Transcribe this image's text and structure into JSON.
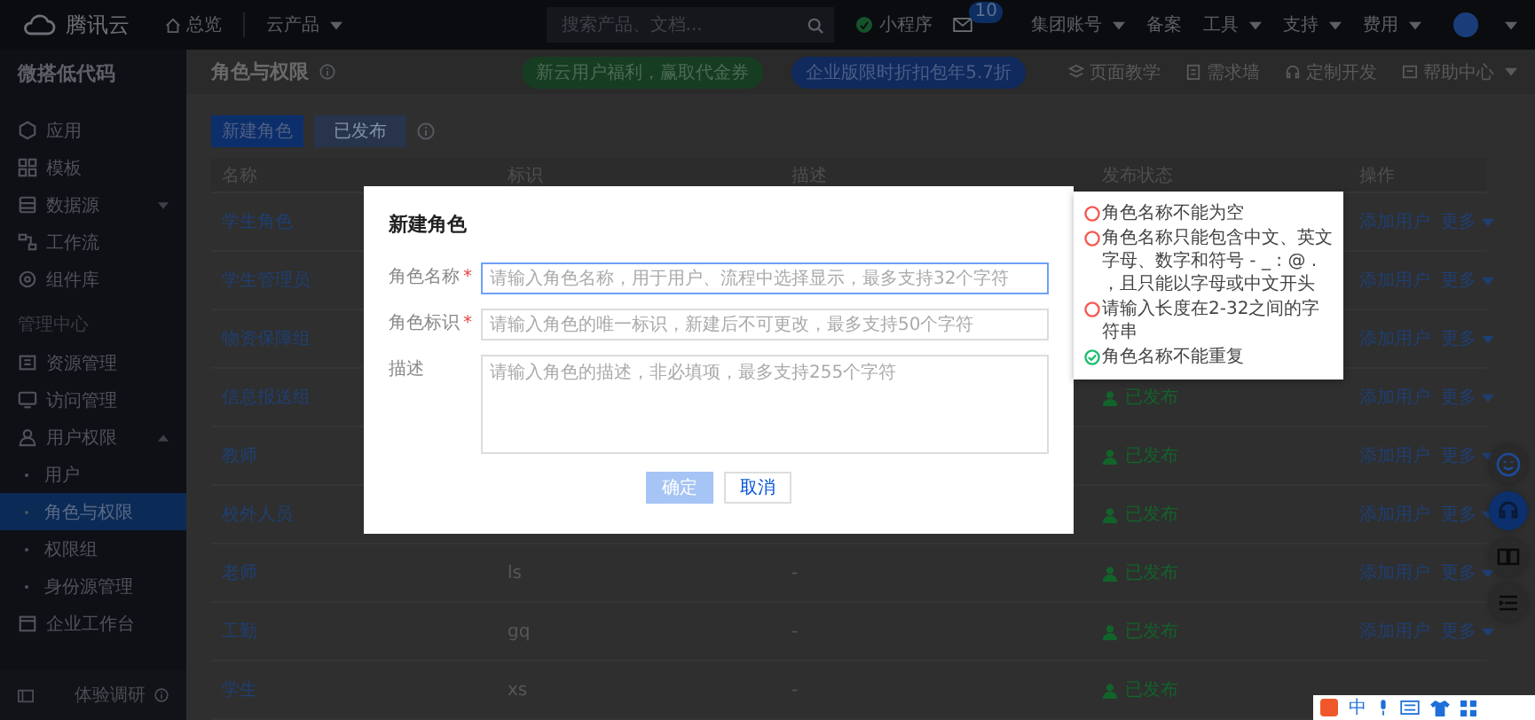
{
  "top_bar": {
    "brand": "腾讯云",
    "home": "总览",
    "products": {
      "label": "云产品",
      "dropdown": true
    },
    "search": {
      "placeholder": "搜索产品、文档..."
    },
    "mini_program": "小程序",
    "mail_badge": "10",
    "menus": [
      {
        "label": "集团账号",
        "dropdown": true
      },
      {
        "label": "备案",
        "dropdown": false
      },
      {
        "label": "工具",
        "dropdown": true
      },
      {
        "label": "支持",
        "dropdown": true
      },
      {
        "label": "费用",
        "dropdown": true
      }
    ]
  },
  "sidebar": {
    "title": "微搭低代码",
    "groups": [
      {
        "items": [
          {
            "label": "应用",
            "selected": false
          },
          {
            "label": "模板",
            "selected": false
          },
          {
            "label": "数据源",
            "selected": false,
            "expanded": false
          },
          {
            "label": "工作流",
            "selected": false
          },
          {
            "label": "组件库",
            "selected": false
          }
        ]
      },
      {
        "heading": "管理中心",
        "items": [
          {
            "label": "资源管理",
            "selected": false
          },
          {
            "label": "访问管理",
            "selected": false
          },
          {
            "label": "用户权限",
            "selected": false,
            "expanded": true,
            "children": [
              {
                "label": "用户",
                "selected": false
              },
              {
                "label": "角色与权限",
                "selected": true
              },
              {
                "label": "权限组",
                "selected": false
              },
              {
                "label": "身份源管理",
                "selected": false
              }
            ]
          },
          {
            "label": "企业工作台",
            "selected": false
          }
        ]
      }
    ],
    "footer": "体验调研"
  },
  "page_header": {
    "title": "角色与权限",
    "promos": [
      {
        "kind": "green",
        "text": "新云用户福利，赢取代金券"
      },
      {
        "kind": "blue",
        "text": "企业版限时折扣包年5.7折"
      }
    ],
    "links": [
      {
        "label": "页面教学",
        "dropdown": false
      },
      {
        "label": "需求墙",
        "dropdown": false
      },
      {
        "label": "定制开发",
        "dropdown": false
      },
      {
        "label": "帮助中心",
        "dropdown": true
      }
    ]
  },
  "toolbar": {
    "buttons": [
      {
        "label": "新建角色",
        "disabled": false
      },
      {
        "label": "已发布",
        "disabled": true
      }
    ]
  },
  "table": {
    "columns": [
      "名称",
      "标识",
      "描述",
      "发布状态",
      "操作"
    ],
    "rows": [
      {
        "name": "学生角色",
        "actions": [
          "添加用户",
          "更多"
        ]
      },
      {
        "name": "学生管理员",
        "actions": [
          "添加用户",
          "更多"
        ]
      },
      {
        "name": "物资保障组",
        "actions": [
          "添加用户",
          "更多"
        ]
      },
      {
        "name": "信息报送组",
        "status": "已发布",
        "actions": [
          "添加用户",
          "更多"
        ]
      },
      {
        "name": "教师",
        "status": "已发布",
        "actions": [
          "添加用户",
          "更多"
        ]
      },
      {
        "name": "校外人员",
        "status": "已发布",
        "actions": [
          "添加用户",
          "更多"
        ]
      },
      {
        "name": "老师",
        "identifier": "ls",
        "description": "-",
        "status": "已发布",
        "actions": [
          "添加用户",
          "更多"
        ]
      },
      {
        "name": "工勤",
        "identifier": "gq",
        "description": "-",
        "status": "已发布",
        "actions": [
          "添加用户",
          "更多"
        ]
      },
      {
        "name": "学生",
        "identifier": "xs",
        "description": "-",
        "status": "已发布"
      }
    ]
  },
  "modal": {
    "title": "新建角色",
    "fields": [
      {
        "kind": "input",
        "label": "角色名称",
        "required_mark": "*",
        "focused": true,
        "placeholder": "请输入角色名称，用于用户、流程中选择显示，最多支持32个字符"
      },
      {
        "kind": "input",
        "label": "角色标识",
        "required_mark": "*",
        "focused": false,
        "placeholder": "请输入角色的唯一标识，新建后不可更改，最多支持50个字符"
      },
      {
        "kind": "textarea",
        "label": "描述",
        "focused": false,
        "placeholder": "请输入角色的描述，非必填项，最多支持255个字符"
      }
    ],
    "buttons": [
      {
        "kind": "primary",
        "label": "确定",
        "disabled": true
      },
      {
        "kind": "default",
        "label": "取消",
        "disabled": false
      }
    ]
  },
  "validation": [
    {
      "text": "角色名称不能为空",
      "passed": false
    },
    {
      "text": "角色名称只能包含中文、英文字母、数字和符号 - _ : @ . ，且只能以字母或中文开头",
      "passed": false
    },
    {
      "text": "请输入长度在2-32之间的字符串",
      "passed": false
    },
    {
      "text": "角色名称不能重复",
      "passed": true
    }
  ],
  "ime_bar": {
    "mode": "中"
  }
}
